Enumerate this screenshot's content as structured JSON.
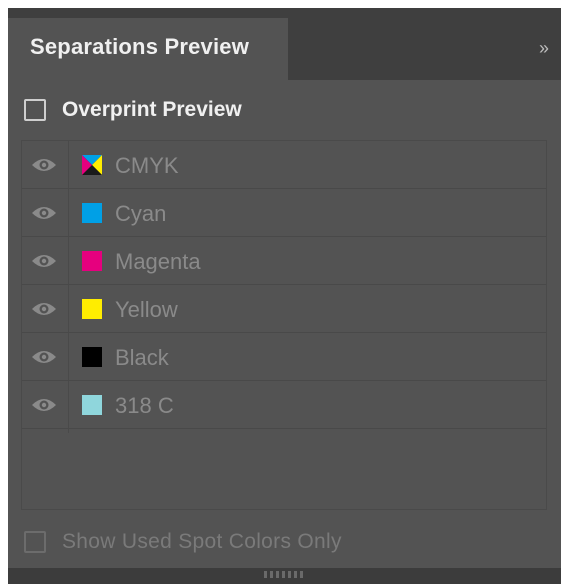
{
  "panel": {
    "title": "Separations Preview",
    "collapse_glyph": "»"
  },
  "overprint": {
    "label": "Overprint Preview",
    "checked": false
  },
  "inks": [
    {
      "name": "CMYK",
      "swatch": "cmyk-composite",
      "visible": true
    },
    {
      "name": "Cyan",
      "swatch": "#00a0e6",
      "visible": true
    },
    {
      "name": "Magenta",
      "swatch": "#e6007e",
      "visible": true
    },
    {
      "name": "Yellow",
      "swatch": "#ffed00",
      "visible": true
    },
    {
      "name": "Black",
      "swatch": "#000000",
      "visible": true
    },
    {
      "name": "318 C",
      "swatch": "#8fd6dc",
      "visible": true
    }
  ],
  "spot_only": {
    "label": "Show Used Spot Colors Only",
    "checked": false,
    "enabled": false
  },
  "colors": {
    "panel_bg": "#535353",
    "tabbar_bg": "#3f3f3f",
    "text_bright": "#f0f0f0",
    "text_dim": "#8a8a8a"
  }
}
